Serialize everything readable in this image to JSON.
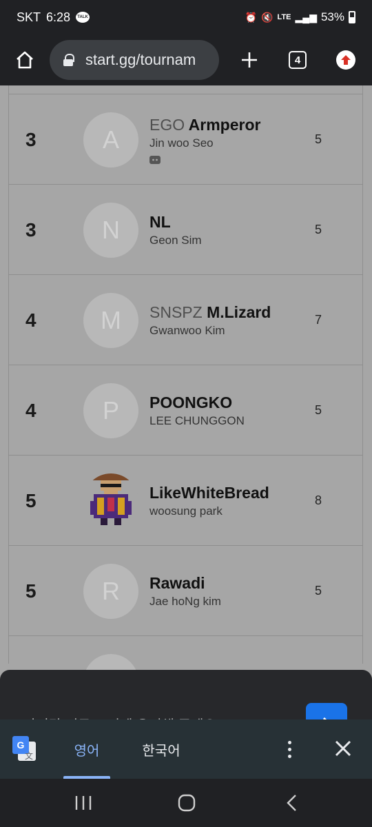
{
  "status_bar": {
    "carrier": "SKT",
    "time": "6:28",
    "talk_badge": "TALK",
    "network": "LTE",
    "battery": "53%"
  },
  "browser": {
    "url": "start.gg/tournam",
    "tab_count": "4"
  },
  "rows": [
    {
      "placing": "3",
      "initial": "A",
      "prefix": "EGO",
      "tag": "Armperor",
      "real_name": "Jin woo Seo",
      "seed": "5",
      "discord": true,
      "avatar": "letter"
    },
    {
      "placing": "3",
      "initial": "N",
      "prefix": "",
      "tag": "NL",
      "real_name": "Geon Sim",
      "seed": "5",
      "avatar": "letter"
    },
    {
      "placing": "4",
      "initial": "M",
      "prefix": "SNSPZ",
      "tag": "M.Lizard",
      "real_name": "Gwanwoo Kim",
      "seed": "7",
      "avatar": "letter"
    },
    {
      "placing": "4",
      "initial": "P",
      "prefix": "",
      "tag": "POONGKO",
      "real_name": "LEE CHUNGGON",
      "seed": "5",
      "avatar": "letter"
    },
    {
      "placing": "5",
      "initial": "",
      "prefix": "",
      "tag": "LikeWhiteBread",
      "real_name": "woosung park",
      "seed": "8",
      "avatar": "pixel-art"
    },
    {
      "placing": "5",
      "initial": "R",
      "prefix": "",
      "tag": "Rawadi",
      "real_name": "Jae hoNg kim",
      "seed": "5",
      "avatar": "letter"
    }
  ],
  "sheet": {
    "text": "마지막 서로 모서에 유리해 주세요"
  },
  "translate": {
    "source_lang": "영어",
    "target_lang": "한국어"
  },
  "colors": {
    "accent": "#8ab4f8",
    "sheet_button": "#1a73e8",
    "update": "#d93025"
  }
}
